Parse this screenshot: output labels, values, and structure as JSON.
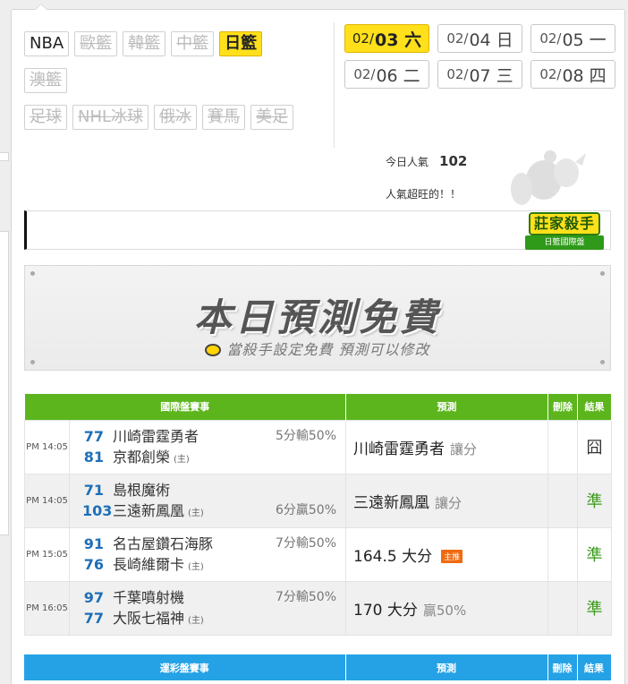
{
  "sports": {
    "row1": [
      {
        "label": "NBA",
        "state": "on"
      },
      {
        "label": "歐籃",
        "state": "off"
      },
      {
        "label": "韓籃",
        "state": "off"
      },
      {
        "label": "中籃",
        "state": "off"
      },
      {
        "label": "日籃",
        "state": "selected"
      }
    ],
    "row2": [
      {
        "label": "澳籃",
        "state": "off"
      }
    ],
    "row3": [
      {
        "label": "足球",
        "state": "off"
      },
      {
        "label": "NHL冰球",
        "state": "off"
      },
      {
        "label": "俄冰",
        "state": "off"
      },
      {
        "label": "賽馬",
        "state": "off"
      },
      {
        "label": "美足",
        "state": "off"
      }
    ]
  },
  "dates": [
    {
      "md": "02/",
      "day": "03 六",
      "selected": true
    },
    {
      "md": "02/",
      "day": "04 日",
      "selected": false
    },
    {
      "md": "02/",
      "day": "05 一",
      "selected": false
    },
    {
      "md": "02/",
      "day": "06 二",
      "selected": false
    },
    {
      "md": "02/",
      "day": "07 三",
      "selected": false
    },
    {
      "md": "02/",
      "day": "08 四",
      "selected": false
    }
  ],
  "popularity": {
    "label": "今日人氣",
    "value": "102",
    "note": "人氣超旺的！！"
  },
  "badge": {
    "title": "莊家殺手",
    "subtitle": "日籃國際盤"
  },
  "banner": {
    "title": "本日預測免費",
    "subtitle": "當殺手設定免費  預測可以修改"
  },
  "intl_table": {
    "headers": {
      "match": "國際盤賽事",
      "prediction": "預測",
      "delete": "刪除",
      "result": "結果"
    },
    "home_mark": "(主)",
    "rows": [
      {
        "time": "PM 14:05",
        "team1": {
          "score": "77",
          "name": "川崎雷霆勇者"
        },
        "team2": {
          "score": "81",
          "name": "京都創榮"
        },
        "odds": "5分輸50%",
        "odds_on": 1,
        "pick": "川崎雷霆勇者",
        "pick_note": "讓分",
        "hot": "",
        "result": "囧",
        "result_type": "bad"
      },
      {
        "time": "PM 14:05",
        "team1": {
          "score": "71",
          "name": "島根魔術"
        },
        "team2": {
          "score": "103",
          "name": "三遠新鳳凰"
        },
        "odds": "6分贏50%",
        "odds_on": 2,
        "pick": "三遠新鳳凰",
        "pick_note": "讓分",
        "hot": "",
        "result": "準",
        "result_type": "ok"
      },
      {
        "time": "PM 15:05",
        "team1": {
          "score": "91",
          "name": "名古屋鑽石海豚"
        },
        "team2": {
          "score": "76",
          "name": "長崎維爾卡"
        },
        "odds": "7分輸50%",
        "odds_on": 1,
        "pick": "164.5 大分",
        "pick_note": "",
        "hot": "主推",
        "result": "準",
        "result_type": "ok"
      },
      {
        "time": "PM 16:05",
        "team1": {
          "score": "97",
          "name": "千葉噴射機"
        },
        "team2": {
          "score": "77",
          "name": "大阪七福神"
        },
        "odds": "7分輸50%",
        "odds_on": 1,
        "pick": "170 大分",
        "pick_note": "贏50%",
        "hot": "",
        "result": "準",
        "result_type": "ok"
      }
    ]
  },
  "sports_table": {
    "headers": {
      "match": "運彩盤賽事",
      "prediction": "預測",
      "delete": "刪除",
      "result": "結果"
    }
  },
  "colors": {
    "selected": "#ffe01a",
    "intl_header": "#5cb51d",
    "sports_header": "#25a2e6",
    "correct": "#3a9a1a"
  }
}
